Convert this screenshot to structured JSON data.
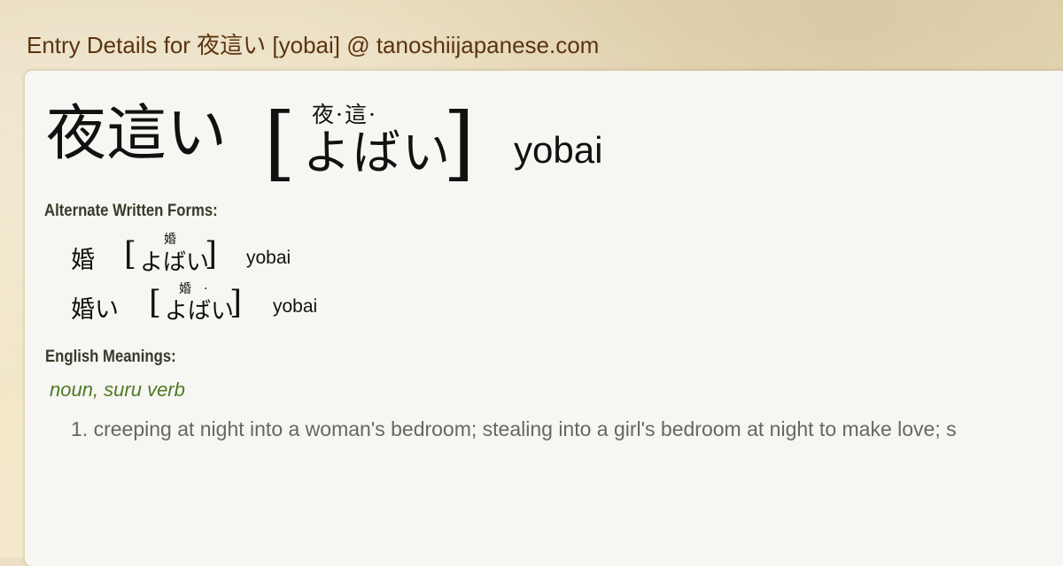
{
  "header": {
    "title": "Entry Details for 夜這い [yobai] @ tanoshiijapanese.com"
  },
  "entry": {
    "kanji": "夜這い",
    "bracket_open": "[",
    "bracket_close": "]",
    "furigana": "夜·這·",
    "kana": "よばい",
    "romaji": "yobai"
  },
  "alternate": {
    "label": "Alternate Written Forms:",
    "forms": [
      {
        "kanji": "婚",
        "furigana": "婚",
        "kana": "よばい",
        "romaji": "yobai"
      },
      {
        "kanji": "婚い",
        "furigana": "婚　·",
        "kana": "よばい",
        "romaji": "yobai"
      }
    ]
  },
  "meanings": {
    "label": "English Meanings:",
    "part_of_speech": "noun, suru verb",
    "items": [
      "1. creeping at night into a woman's bedroom; stealing into a girl's bedroom at night to make love; s"
    ]
  }
}
